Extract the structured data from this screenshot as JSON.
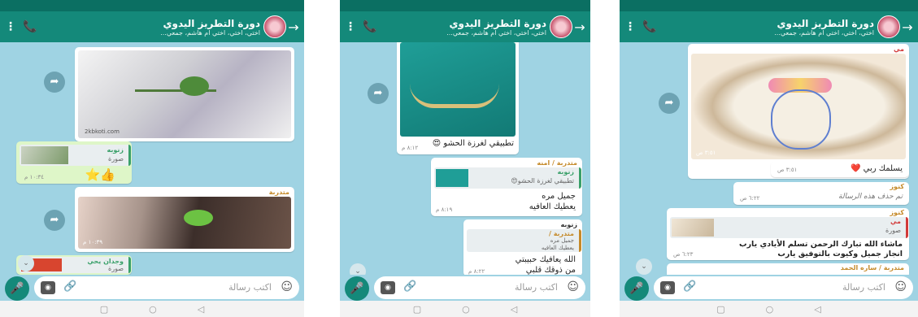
{
  "group": {
    "title": "دورة التطريز اليدوي",
    "subtitle": "اختي، اختي، اختي ام هاشم، جمعي..."
  },
  "composer": {
    "placeholder": "اكتب رسالة"
  },
  "icons": {
    "menu": "menu-icon",
    "call": "call-add-icon",
    "back": "back-arrow-icon",
    "forward": "forward-icon",
    "mic": "mic-icon",
    "camera": "camera-icon",
    "attach": "attach-icon",
    "emoji": "emoji-icon",
    "scroll": "scroll-down-icon"
  },
  "colors": {
    "header": "#14897a",
    "statusbar": "#0b6f62",
    "chat_bg": "#9fd3e3",
    "outgoing": "#def6c8",
    "mic": "#14897a"
  },
  "screen1": {
    "img1_caption": "2kbkoti.com",
    "reply1": {
      "name": "زنوبه",
      "label": "صورة",
      "time": "١٠:٣٤ م",
      "stickers": "⭐👍"
    },
    "img2_sender": "متدربة",
    "img2_time": "١٠:٣٩ م",
    "reply2": {
      "name": "وجدان يحي",
      "label": "صورة"
    }
  },
  "screen2": {
    "img_caption": "تطبيقي لغرزة الحشو 😍",
    "img_time": "٨:١٢ م",
    "msg1": {
      "sender": "متدربة / امنه",
      "quote_name": "زنوبه",
      "quote_text": "تطبيقي لغرزة الحشو😍",
      "line1": "جميل مره",
      "line2": "يعطيك العافيه",
      "time": "٨:١٩ م"
    },
    "msg2": {
      "sender": "زنوبه",
      "quote_name": "متدربة /",
      "quote_text1": "جميل مره",
      "quote_text2": "يعطيك العافيه",
      "line1": "الله يعافيك حبيبتي",
      "line2": "من ذوقك قلبي",
      "time": "٨:٢٢ م"
    }
  },
  "screen3": {
    "img_sender": "مي",
    "img_time": "٣:٥١ ص",
    "msg1": {
      "text": "يسلمك ربي ❤️",
      "time": "٣:٥١ ص"
    },
    "msg2": {
      "sender": "كنوز",
      "text": "تم حذف هذه الرسالة",
      "time": "٦:٢٢ ص"
    },
    "msg3": {
      "sender": "كنوز",
      "quote_name": "مي",
      "quote_label": "صورة",
      "line1": "ماشاء الله تبارك الرحمن تسلم الأيادي يارب",
      "line2": "انجاز جميل وكيوت بالتوفيق يارب",
      "time": "٦:٢٣ ص"
    },
    "msg4": {
      "sender": "متدربة / ساره الحمد"
    }
  }
}
